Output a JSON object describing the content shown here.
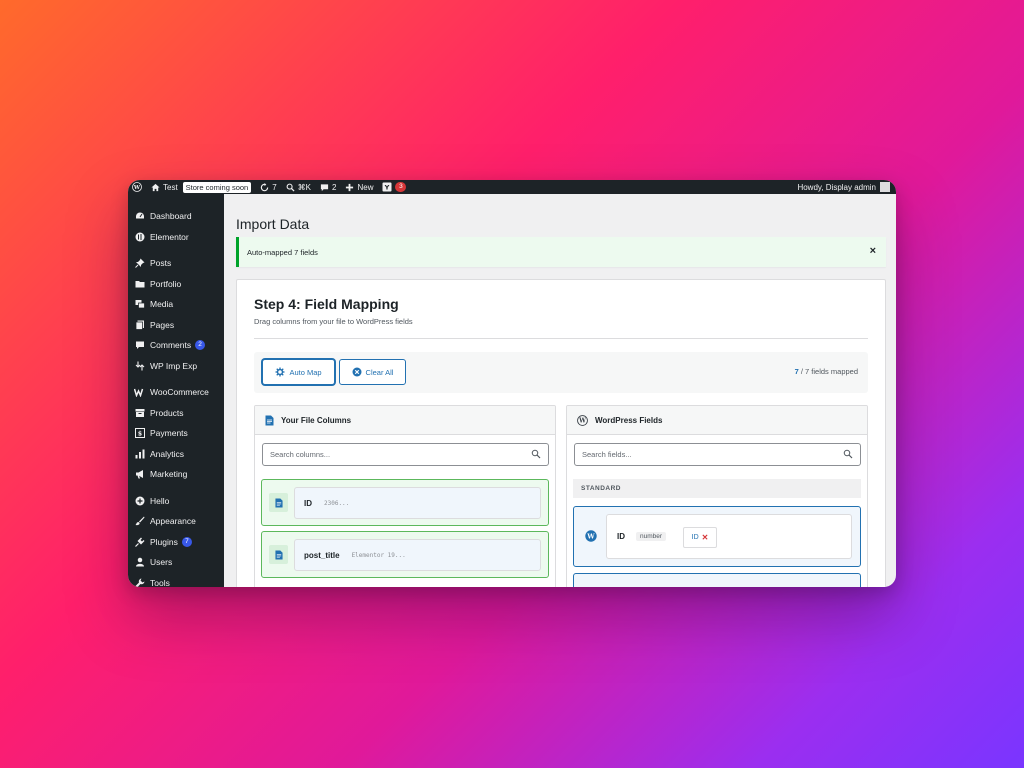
{
  "adminbar": {
    "site_name": "Test",
    "store_badge": "Store coming soon",
    "updates_count": "7",
    "search_shortcut": "⌘K",
    "comments_count": "2",
    "new_label": "New",
    "yoast_count": "3",
    "greeting": "Howdy, Display admin"
  },
  "sidebar": {
    "items": [
      {
        "label": "Dashboard",
        "icon": "dashboard-icon"
      },
      {
        "label": "Elementor",
        "icon": "elementor-icon"
      },
      {
        "label": "Posts",
        "icon": "pin-icon"
      },
      {
        "label": "Portfolio",
        "icon": "folder-icon"
      },
      {
        "label": "Media",
        "icon": "media-icon"
      },
      {
        "label": "Pages",
        "icon": "pages-icon"
      },
      {
        "label": "Comments",
        "icon": "comment-icon",
        "badge": "2"
      },
      {
        "label": "WP Imp Exp",
        "icon": "import-export-icon"
      },
      {
        "label": "WooCommerce",
        "icon": "woocommerce-icon"
      },
      {
        "label": "Products",
        "icon": "archive-icon"
      },
      {
        "label": "Payments",
        "icon": "payments-icon"
      },
      {
        "label": "Analytics",
        "icon": "bar-chart-icon"
      },
      {
        "label": "Marketing",
        "icon": "megaphone-icon"
      },
      {
        "label": "Hello",
        "icon": "plus-circle-icon"
      },
      {
        "label": "Appearance",
        "icon": "brush-icon"
      },
      {
        "label": "Plugins",
        "icon": "plugin-icon",
        "badge": "7"
      },
      {
        "label": "Users",
        "icon": "user-icon"
      },
      {
        "label": "Tools",
        "icon": "wrench-icon"
      }
    ]
  },
  "page": {
    "title": "Import Data",
    "notice": "Auto-mapped 7 fields",
    "notice_close": "×"
  },
  "step": {
    "title": "Step 4: Field Mapping",
    "subtitle": "Drag columns from your file to WordPress fields"
  },
  "toolbar": {
    "auto_map": "Auto Map",
    "clear_all": "Clear All",
    "mapped_num": "7",
    "mapped_rest": " / 7 fields mapped"
  },
  "file_columns": {
    "title": "Your File Columns",
    "search_placeholder": "Search columns...",
    "items": [
      {
        "name": "ID",
        "sample": "2306..."
      },
      {
        "name": "post_title",
        "sample": "Elementor 19..."
      }
    ]
  },
  "wp_fields": {
    "title": "WordPress Fields",
    "search_placeholder": "Search fields...",
    "group_label": "STANDARD",
    "items": [
      {
        "name": "ID",
        "type": "number",
        "mapped_to": "ID",
        "remove": "✕"
      }
    ]
  },
  "colors": {
    "accent": "#2271b1",
    "success": "#00a32a",
    "admin_bg": "#1d2327",
    "danger": "#d63638"
  }
}
